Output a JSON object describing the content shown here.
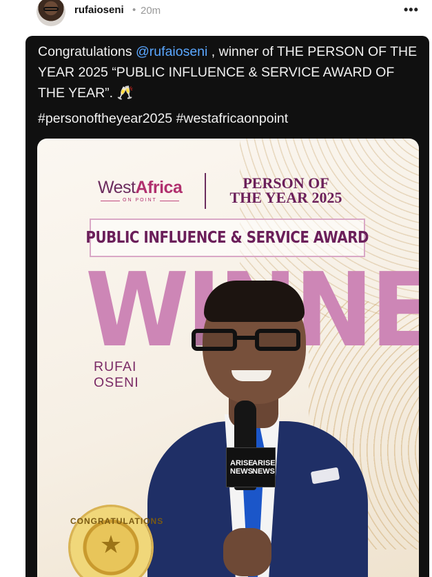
{
  "header": {
    "username": "rufaioseni",
    "separator": "•",
    "time_ago": "20m",
    "more_label": "•••"
  },
  "post": {
    "caption_before": "Congratulations ",
    "mention": "@rufaioseni",
    "caption_after": " , winner of THE PERSON OF THE YEAR 2025 “PUBLIC INFLUENCE & SERVICE AWARD OF THE YEAR”. 🥂",
    "hashtags": "#personoftheyear2025 #westafricaonpoint"
  },
  "poster": {
    "logo_west": "West",
    "logo_africa": "Africa",
    "logo_tagline": "ON POINT",
    "title_line1": "PERSON OF",
    "title_line2": "THE YEAR 2025",
    "award": "PUBLIC INFLUENCE & SERVICE AWARD",
    "winner_word": "WINNER",
    "winner_first": "RUFAI",
    "winner_last": "OSENI",
    "mic_label_1": "ARISE NEWS",
    "mic_label_2": "ARISE NEWS",
    "seal_text": "CONGRATULATIONS"
  },
  "colors": {
    "card_bg": "#101010",
    "mention": "#5aa7ff",
    "brand_plum": "#6b1f5a",
    "winner_pink": "#cd86b6"
  }
}
